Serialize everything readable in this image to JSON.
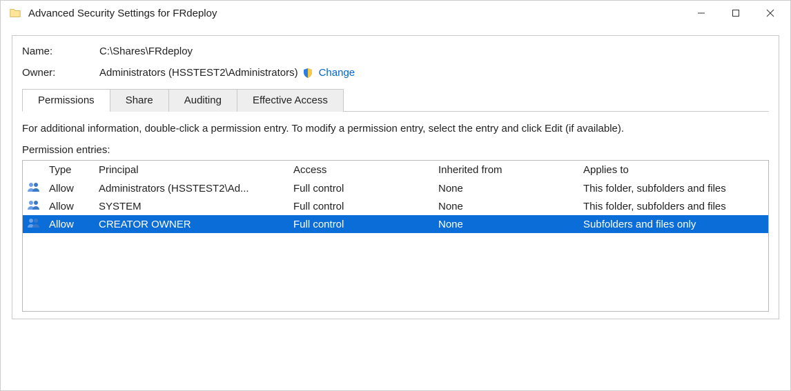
{
  "window": {
    "title": "Advanced Security Settings for FRdeploy"
  },
  "fields": {
    "name_label": "Name:",
    "name_value": "C:\\Shares\\FRdeploy",
    "owner_label": "Owner:",
    "owner_value": "Administrators (HSSTEST2\\Administrators)",
    "change_label": "Change"
  },
  "tabs": {
    "permissions": "Permissions",
    "share": "Share",
    "auditing": "Auditing",
    "effective": "Effective Access",
    "active": "permissions"
  },
  "help": "For additional information, double-click a permission entry. To modify a permission entry, select the entry and click Edit (if available).",
  "entries_label": "Permission entries:",
  "columns": {
    "type": "Type",
    "principal": "Principal",
    "access": "Access",
    "inherited": "Inherited from",
    "applies": "Applies to"
  },
  "entries": [
    {
      "type": "Allow",
      "principal": "Administrators (HSSTEST2\\Ad...",
      "access": "Full control",
      "inherited": "None",
      "applies": "This folder, subfolders and files",
      "selected": false
    },
    {
      "type": "Allow",
      "principal": "SYSTEM",
      "access": "Full control",
      "inherited": "None",
      "applies": "This folder, subfolders and files",
      "selected": false
    },
    {
      "type": "Allow",
      "principal": "CREATOR OWNER",
      "access": "Full control",
      "inherited": "None",
      "applies": "Subfolders and files only",
      "selected": true
    }
  ]
}
